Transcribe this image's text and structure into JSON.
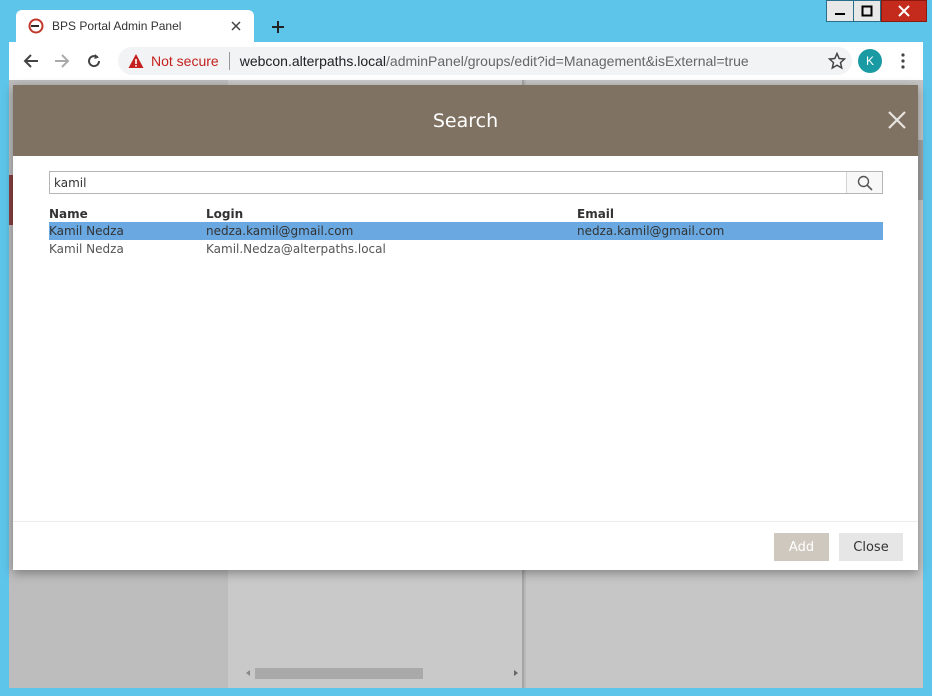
{
  "browser": {
    "tab_title": "BPS Portal Admin Panel",
    "security_label": "Not secure",
    "url_host": "webcon.alterpaths.local",
    "url_path": "/adminPanel/groups/edit?id=Management&isExternal=true",
    "profile_initial": "K",
    "accent_color": "#1a9ba3"
  },
  "modal": {
    "title": "Search",
    "search_value": "kamil",
    "columns": {
      "name": "Name",
      "login": "Login",
      "email": "Email"
    },
    "rows": [
      {
        "name": "Kamil Nedza",
        "login": "nedza.kamil@gmail.com",
        "email": "nedza.kamil@gmail.com",
        "selected": true
      },
      {
        "name": "Kamil Nedza",
        "login": "Kamil.Nedza@alterpaths.local",
        "email": "",
        "selected": false
      }
    ],
    "add_label": "Add",
    "close_label": "Close",
    "header_color": "#7f7262",
    "selection_color": "#69a8e0"
  }
}
